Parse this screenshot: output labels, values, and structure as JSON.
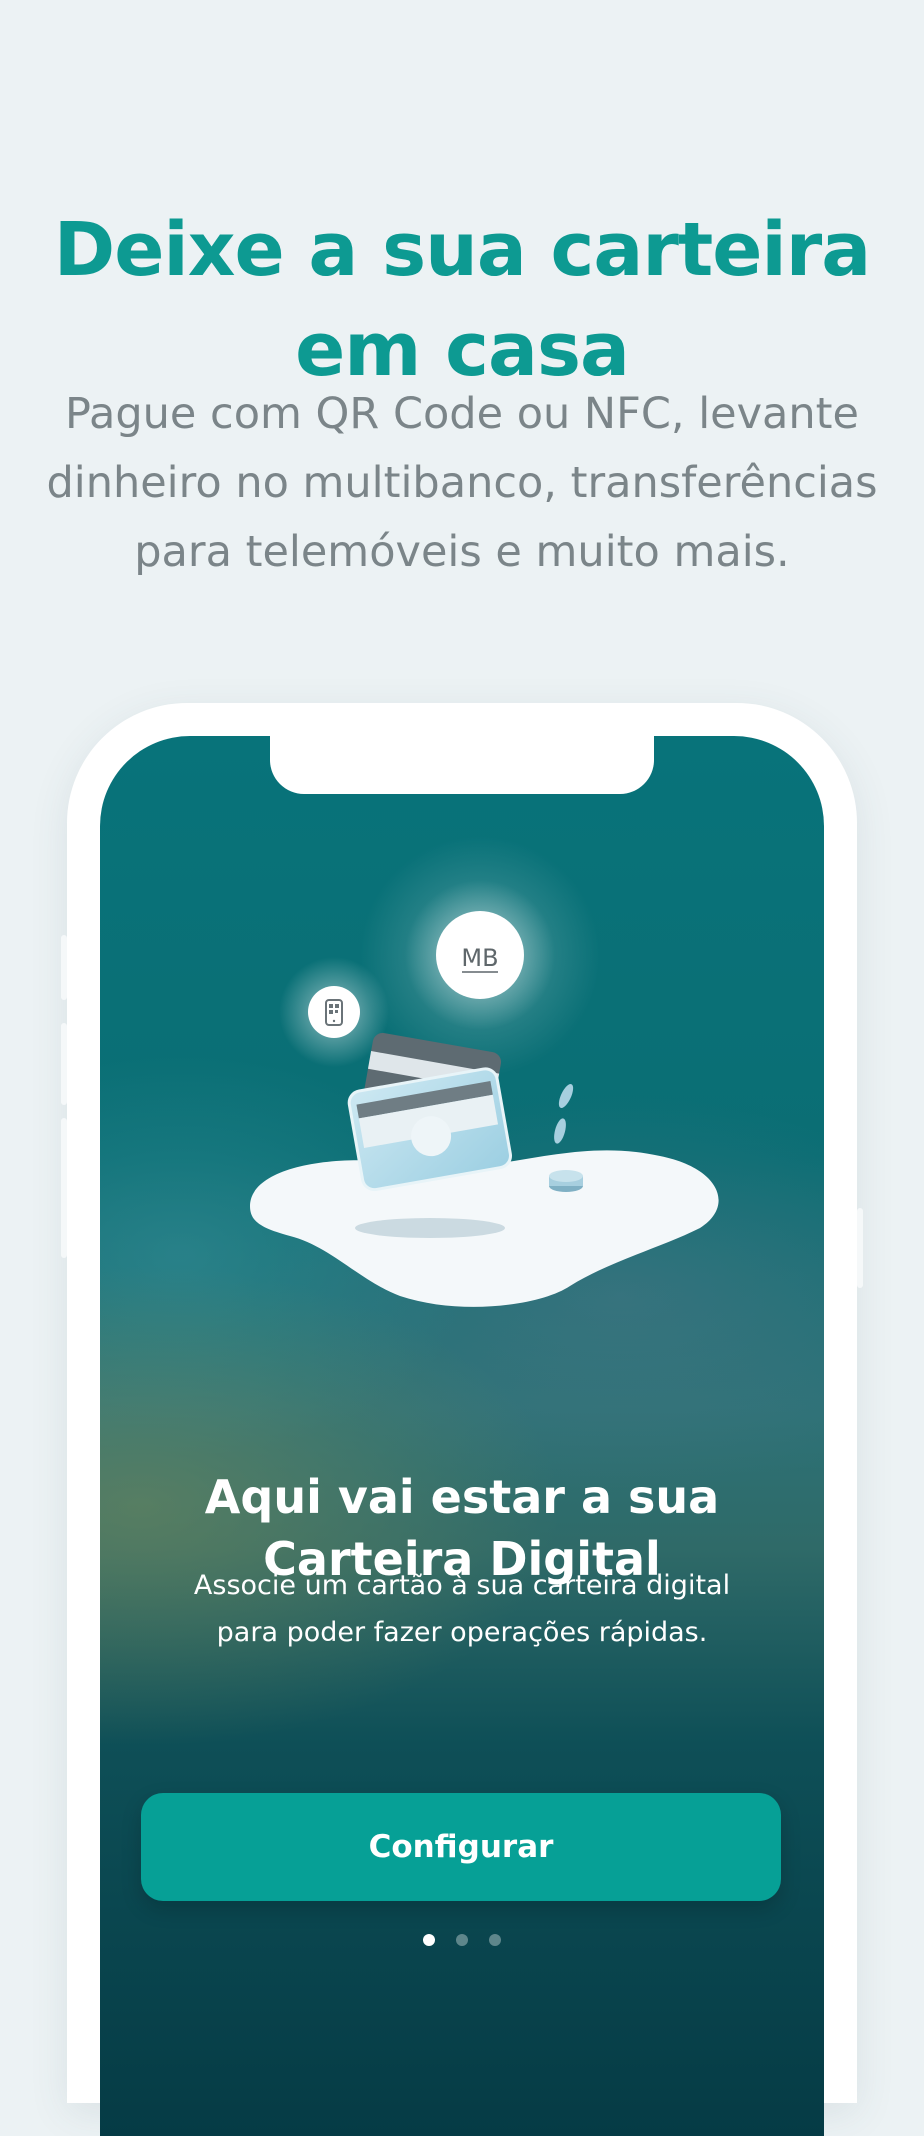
{
  "promo": {
    "headline_line1": "Deixe a sua carteira",
    "headline_line2": "em casa",
    "subtitle_line1": "Pague com QR Code ou NFC, levante",
    "subtitle_line2": "dinheiro no multibanco, transferências",
    "subtitle_line3": "para telemóveis e muito mais."
  },
  "screen": {
    "badge_mb": "MB",
    "title_line1": "Aqui vai estar a sua",
    "title_line2": "Carteira Digital",
    "description_line1": "Associe um cartão à sua carteira digital",
    "description_line2": "para poder fazer operações rápidas.",
    "cta_label": "Configurar",
    "pagination": {
      "total": 3,
      "active": 1
    }
  },
  "colors": {
    "accent": "#0d9a92",
    "button": "#06a096",
    "subtitle": "#7b8589",
    "background": "#ecf2f4"
  },
  "icons": [
    "qr-phone-icon",
    "mb-icon",
    "cards-icon",
    "coins-icon"
  ]
}
